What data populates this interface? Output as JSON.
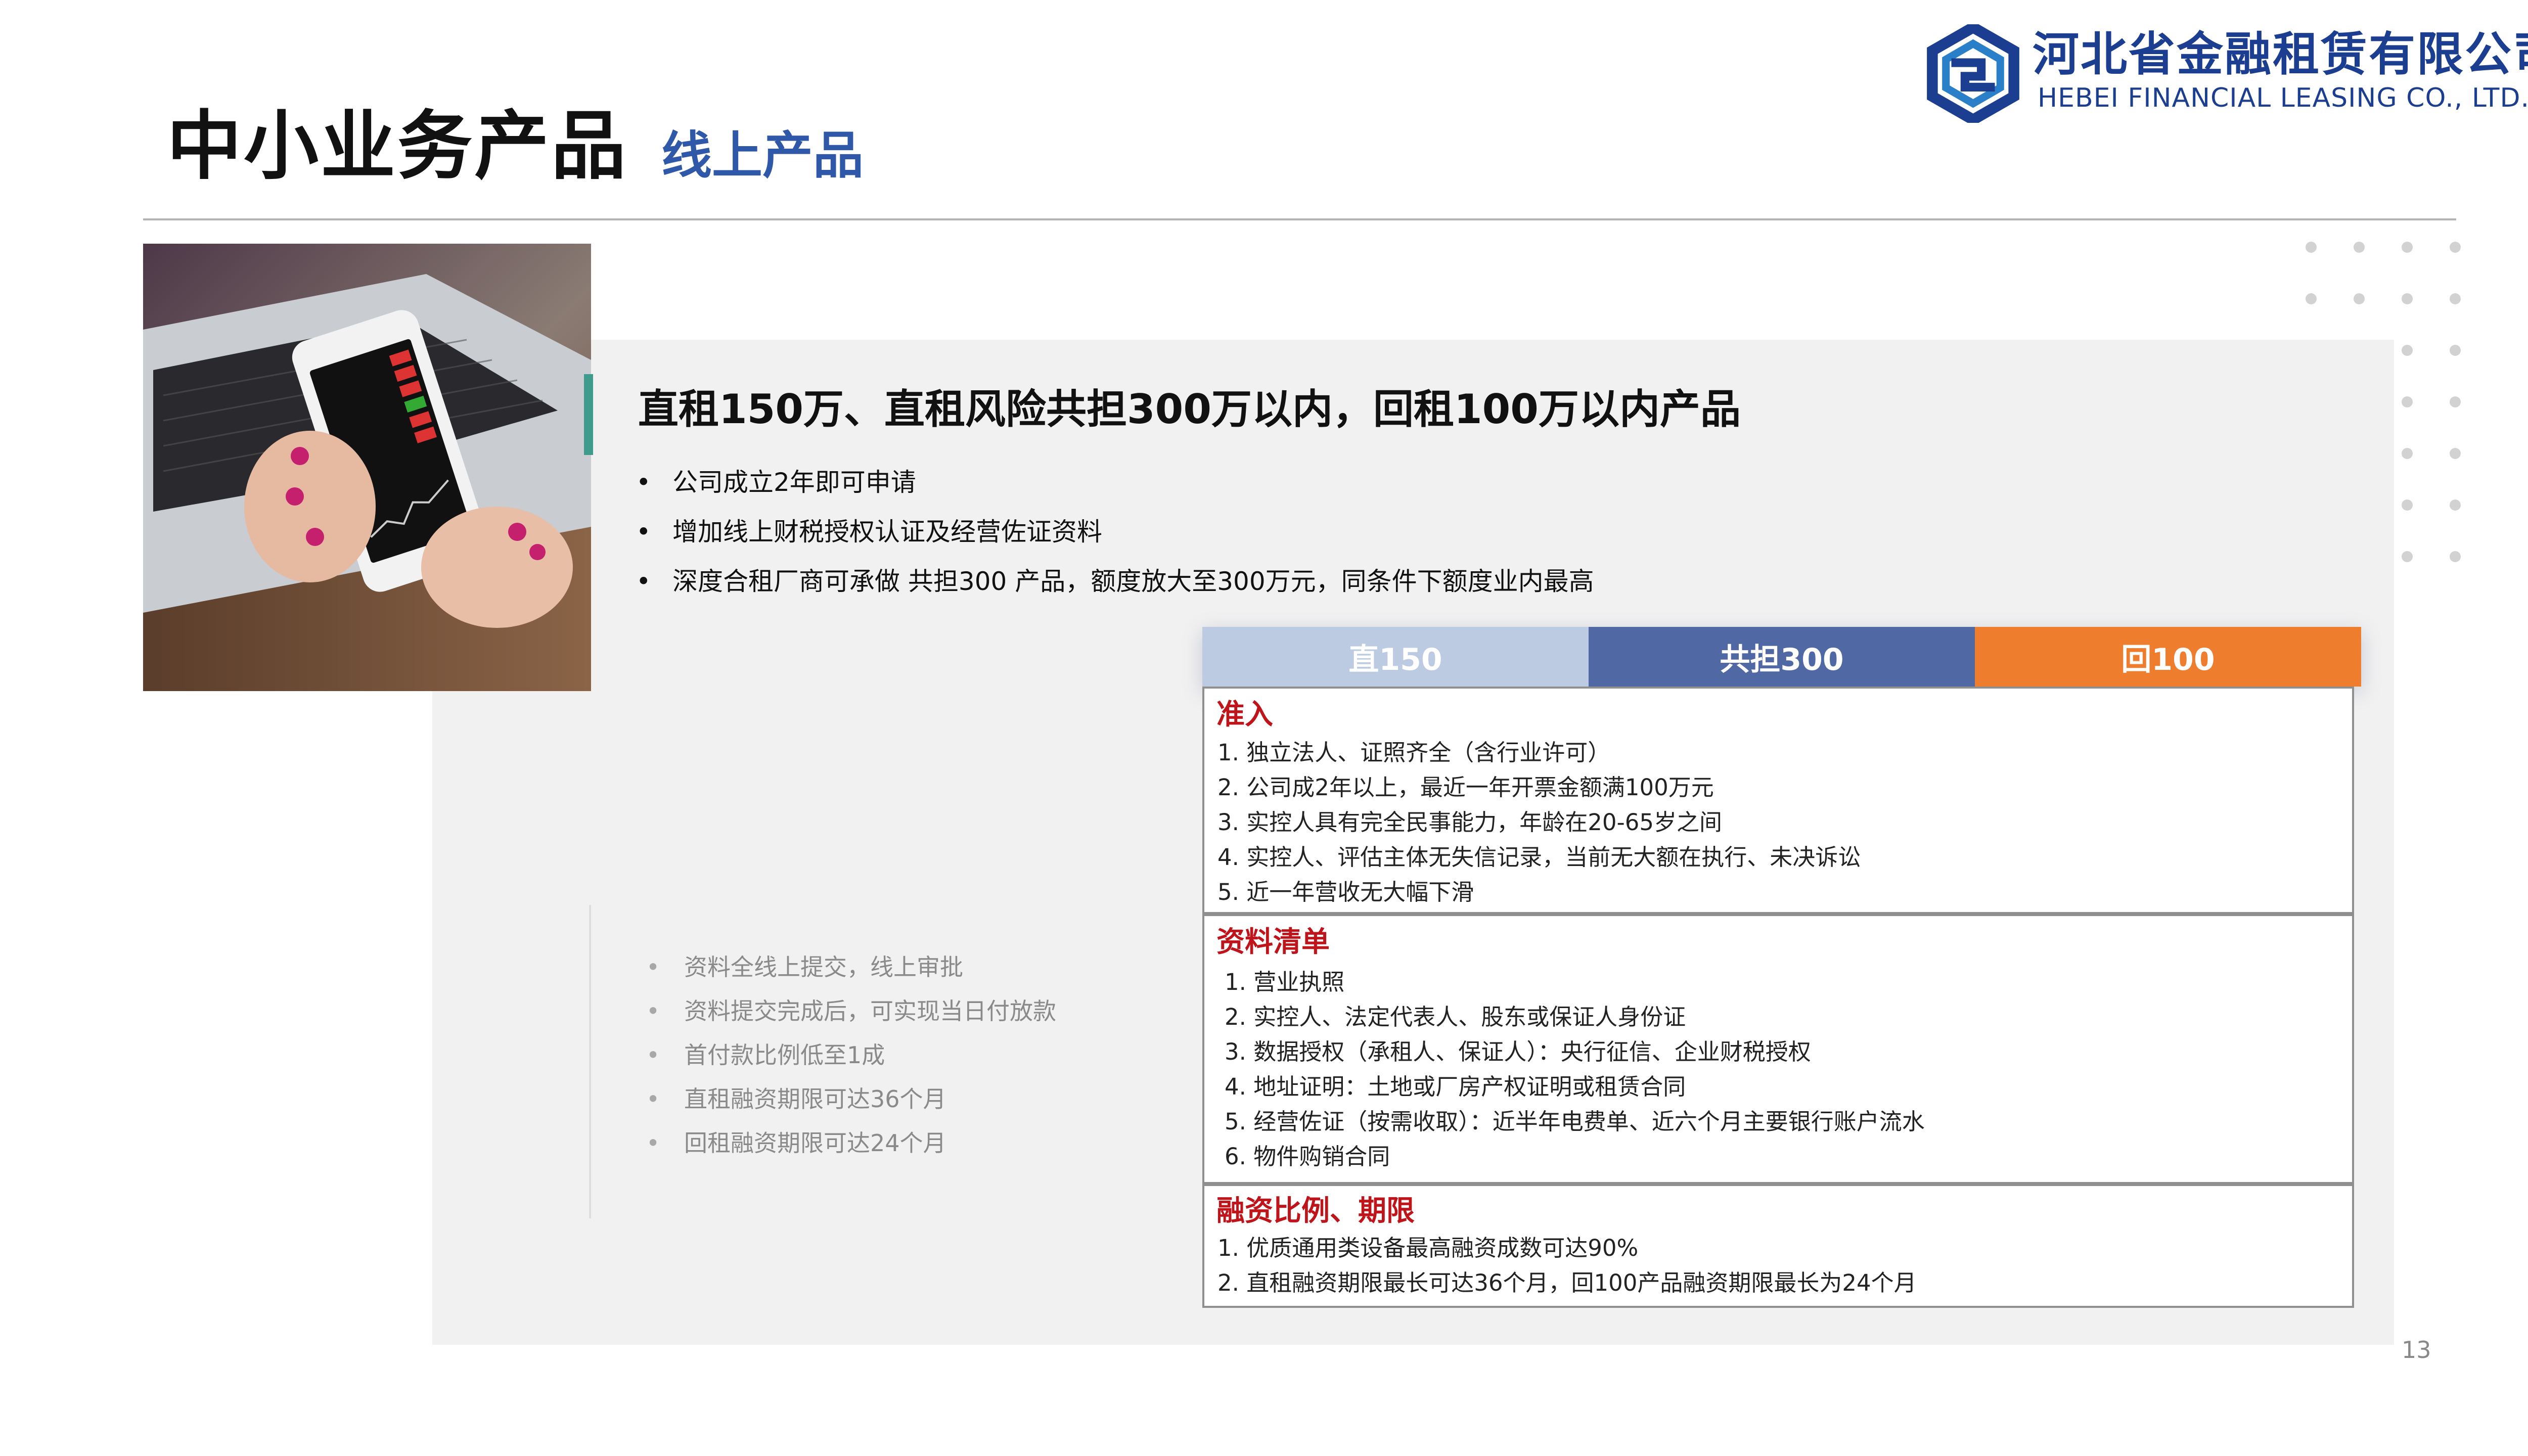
{
  "header": {
    "title": "中小业务产品",
    "subtitle": "线上产品"
  },
  "logo": {
    "name_cn": "河北省金融租赁有限公司",
    "name_en": "HEBEI FINANCIAL LEASING CO., LTD.",
    "colors": {
      "primary": "#1c3e91",
      "secondary": "#2a7fc9"
    }
  },
  "photo": {
    "icon": "phone-on-laptop-photo"
  },
  "main": {
    "heading": "直租150万、直租风险共担300万以内，回租100万以内产品",
    "features": [
      "公司成立2年即可申请",
      "增加线上财税授权认证及经营佐证资料",
      "深度合租厂商可承做 共担300 产品，额度放大至300万元，同条件下额度业内最高"
    ],
    "side_points": [
      "资料全线上提交，线上审批",
      "资料提交完成后，可实现当日付放款",
      "首付款比例低至1成",
      "直租融资期限可达36个月",
      "回租融资期限可达24个月"
    ]
  },
  "tabs": [
    {
      "label": "直150",
      "color": "#bccbe1"
    },
    {
      "label": "共担300",
      "color": "#5068a4"
    },
    {
      "label": "回100",
      "color": "#ef7d2e"
    }
  ],
  "sections": {
    "admission": {
      "title": "准入",
      "items": [
        "1.  独立法人、证照齐全（含行业许可）",
        "2. 公司成2年以上，最近一年开票金额满100万元",
        "3. 实控人具有完全民事能力，年龄在20-65岁之间",
        "4. 实控人、评估主体无失信记录，当前无大额在执行、未决诉讼",
        "5. 近一年营收无大幅下滑"
      ]
    },
    "documents": {
      "title": "资料清单",
      "items": [
        "1. 营业执照",
        "2. 实控人、法定代表人、股东或保证人身份证",
        "3. 数据授权（承租人、保证人）：央行征信、企业财税授权",
        "4. 地址证明：土地或厂房产权证明或租赁合同",
        "5. 经营佐证（按需收取）：近半年电费单、近六个月主要银行账户流水",
        "6. 物件购销合同"
      ]
    },
    "financing": {
      "title": "融资比例、期限",
      "items": [
        "1.    优质通用类设备最高融资成数可达90%",
        "2.    直租融资期限最长可达36个月，回100产品融资期限最长为24个月"
      ]
    }
  },
  "page_number": "13",
  "accent_color": "#c0141b"
}
